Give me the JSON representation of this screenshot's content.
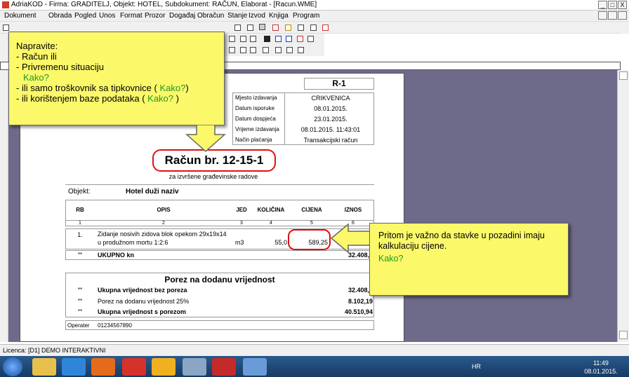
{
  "window": {
    "title": "AdriaKOD - Firma: GRADITELJ,  Objekt: HOTEL,  Subdokument: RAČUN,  Elaborat - [Racun.WME]",
    "min": "_",
    "max": "□",
    "close": "X"
  },
  "menu": [
    "Dokument",
    "Obrada",
    "Pogled",
    "Unos",
    "Format",
    "Prozor",
    "Događaj",
    "Obračun",
    "Stanje",
    "Izvod",
    "Knjiga",
    "Program"
  ],
  "invoice": {
    "code": "R-1",
    "meta": [
      [
        "Mjesto izdavanja",
        "CRIKVENICA"
      ],
      [
        "Datum isporuke",
        "08.01.2015."
      ],
      [
        "Datum dospjeća",
        "23.01.2015."
      ],
      [
        "Vrijeme izdavanja",
        "08.01.2015. 11:43:01"
      ],
      [
        "Način plaćanja",
        "Transakcijski račun"
      ]
    ],
    "title": "Račun br. 12-15-1",
    "subtitle": "za izvršene građevinske radove",
    "object_label": "Objekt:",
    "object_value": "Hotel duži naziv",
    "headers": [
      "RB",
      "OPIS",
      "JED",
      "KOLIČINA",
      "CIJENA",
      "IZNOS"
    ],
    "col_numbers": [
      "1",
      "2",
      "3",
      "4",
      "5",
      "6"
    ],
    "item": {
      "rb": "1.",
      "opis1": "Zidanje nosivih zidova blok opekom 29x19x14",
      "opis2": "u produžnom mortu 1:2:6",
      "jed": "m3",
      "kolicina": "55,0",
      "cijena": "589,25"
    },
    "total_mark": "**",
    "total_label": "UKUPNO kn",
    "total_value": "32.408,7",
    "tax_title": "Porez na dodanu vrijednost",
    "tax_rows": [
      [
        "**",
        "Ukupna vrijednost bez poreza",
        "32.408,7"
      ],
      [
        "**",
        "Porez na dodanu vrijednost 25%",
        "8.102,19"
      ],
      [
        "**",
        "Ukupna vrijednost s porezom",
        "40.510,94"
      ]
    ],
    "operator_label": "Operater",
    "operator_value": "01234567890"
  },
  "callout1": {
    "l1": "Napravite:",
    "l2": "- Račun ili",
    "l3": "- Privremenu situaciju",
    "l4": "Kako?",
    "l5a": "- ili samo troškovnik sa tipkovnice ( ",
    "l5b": "Kako?",
    "l5c": ")",
    "l6a": "- ili korištenjem baze podataka ( ",
    "l6b": "Kako?",
    "l6c": " )"
  },
  "callout2": {
    "l1": "Pritom je važno da stavke u pozadini imaju",
    "l2": "kalkulaciju cijene.",
    "l3": "Kako?"
  },
  "status": "Licenca: [D1] DEMO INTERAKTIVNI",
  "tray": {
    "lang": "HR",
    "time": "11:49",
    "date": "08.01.2015."
  }
}
